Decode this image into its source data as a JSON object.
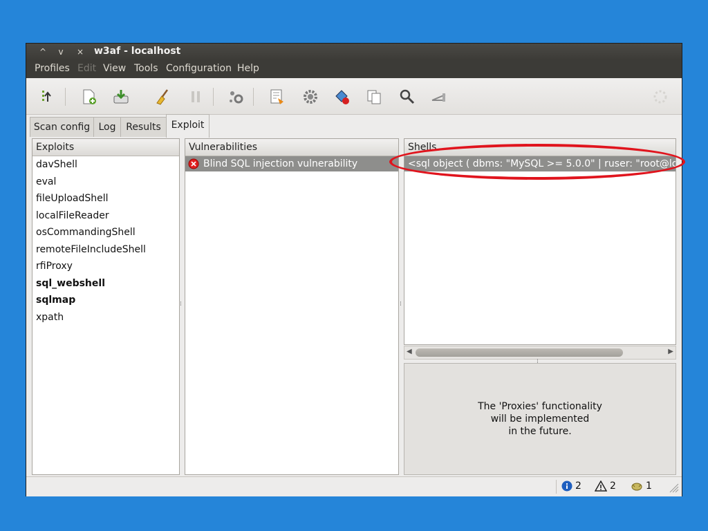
{
  "window": {
    "title": "w3af - localhost",
    "controls": {
      "minimize": "^",
      "maximize": "v",
      "close": "×"
    }
  },
  "menubar": {
    "items": [
      {
        "label": "Profiles",
        "enabled": true
      },
      {
        "label": "Edit",
        "enabled": false
      },
      {
        "label": "View",
        "enabled": true
      },
      {
        "label": "Tools",
        "enabled": true
      },
      {
        "label": "Configuration",
        "enabled": true
      },
      {
        "label": "Help",
        "enabled": true
      }
    ]
  },
  "toolbar": {
    "icons": [
      "wizard-icon",
      "new-profile-icon",
      "save-profile-icon",
      "clear-icon",
      "pause-icon",
      "multi-config-icon",
      "manual-request-icon",
      "settings-icon",
      "fuzzy-request-icon",
      "compare-icon",
      "search-icon",
      "proxy-icon",
      "throbber-icon"
    ]
  },
  "tabs": [
    {
      "label": "Scan config",
      "active": false
    },
    {
      "label": "Log",
      "active": false
    },
    {
      "label": "Results",
      "active": false
    },
    {
      "label": "Exploit",
      "active": true
    }
  ],
  "exploits": {
    "header": "Exploits",
    "items": [
      {
        "label": "davShell",
        "bold": false
      },
      {
        "label": "eval",
        "bold": false
      },
      {
        "label": "fileUploadShell",
        "bold": false
      },
      {
        "label": "localFileReader",
        "bold": false
      },
      {
        "label": "osCommandingShell",
        "bold": false
      },
      {
        "label": "remoteFileIncludeShell",
        "bold": false
      },
      {
        "label": "rfiProxy",
        "bold": false
      },
      {
        "label": "sql_webshell",
        "bold": true
      },
      {
        "label": "sqlmap",
        "bold": true
      },
      {
        "label": "xpath",
        "bold": false
      }
    ]
  },
  "vulnerabilities": {
    "header": "Vulnerabilities",
    "items": [
      {
        "label": "Blind SQL injection vulnerability",
        "icon": "error-icon"
      }
    ]
  },
  "shells": {
    "header": "Shells",
    "items": [
      {
        "label": "<sql object ( dbms: \"MySQL >= 5.0.0\" | ruser: \"root@loc"
      }
    ]
  },
  "proxies_message": "The 'Proxies' functionality\nwill be implemented\nin the future.",
  "statusbar": {
    "info_count": "2",
    "warning_count": "2",
    "vuln_count": "1"
  },
  "colors": {
    "highlight_ellipse": "#e0141d",
    "selection": "#8e8e8c",
    "background": "#2585d9"
  }
}
